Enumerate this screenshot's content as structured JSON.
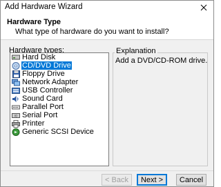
{
  "window": {
    "title": "Add Hardware Wizard"
  },
  "header": {
    "title": "Hardware Type",
    "subtitle": "What type of hardware do you want to install?"
  },
  "list": {
    "label": "Hardware types:",
    "items": [
      {
        "label": "Hard Disk",
        "icon": "hard-disk-icon"
      },
      {
        "label": "CD/DVD Drive",
        "icon": "cd-dvd-icon",
        "selected": true
      },
      {
        "label": "Floppy Drive",
        "icon": "floppy-icon"
      },
      {
        "label": "Network Adapter",
        "icon": "network-adapter-icon"
      },
      {
        "label": "USB Controller",
        "icon": "usb-icon"
      },
      {
        "label": "Sound Card",
        "icon": "sound-card-icon"
      },
      {
        "label": "Parallel Port",
        "icon": "parallel-port-icon"
      },
      {
        "label": "Serial Port",
        "icon": "serial-port-icon"
      },
      {
        "label": "Printer",
        "icon": "printer-icon"
      },
      {
        "label": "Generic SCSI Device",
        "icon": "scsi-device-icon"
      }
    ]
  },
  "explanation": {
    "label": "Explanation",
    "text": "Add a DVD/CD-ROM drive."
  },
  "buttons": {
    "back": "< Back",
    "next": "Next >",
    "cancel": "Cancel"
  },
  "colors": {
    "selection": "#0078d7"
  }
}
